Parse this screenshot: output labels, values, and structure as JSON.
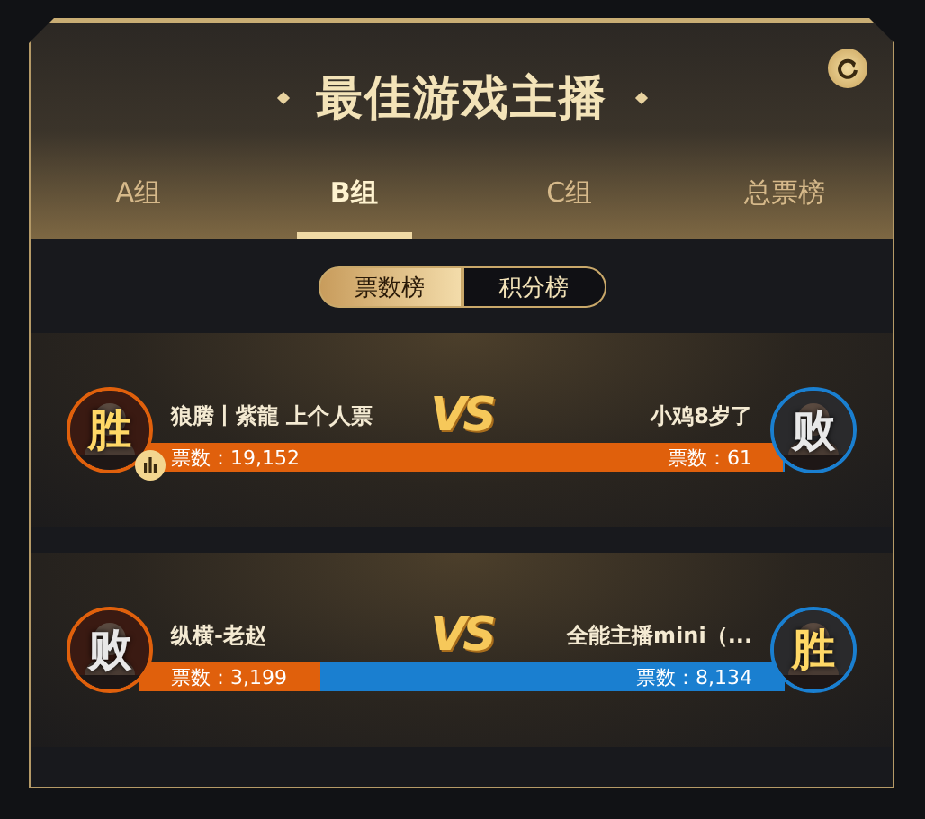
{
  "title": "最佳游戏主播",
  "tabs": [
    {
      "label": "A组",
      "selected": false
    },
    {
      "label": "B组",
      "selected": true
    },
    {
      "label": "C组",
      "selected": false
    },
    {
      "label": "总票榜",
      "selected": false
    }
  ],
  "rank_toggle": [
    {
      "label": "票数榜",
      "selected": true
    },
    {
      "label": "积分榜",
      "selected": false
    }
  ],
  "matches": [
    {
      "vs_label": "VS",
      "level": 0.997,
      "left": {
        "name": "狼腾丨紫龍 上个人票",
        "votes": "票数：19,152",
        "result": "胜",
        "won": true,
        "stats_badge": true
      },
      "right": {
        "name": "小鸡8岁了",
        "votes": "票数：61",
        "result": "败",
        "won": false
      }
    },
    {
      "vs_label": "VS",
      "level": 0.28,
      "left": {
        "name": "纵横-老赵",
        "votes": "票数：3,199",
        "result": "败",
        "won": false
      },
      "right": {
        "name": "全能主播mini（...",
        "votes": "票数：8,134",
        "result": "胜",
        "won": true
      }
    }
  ]
}
